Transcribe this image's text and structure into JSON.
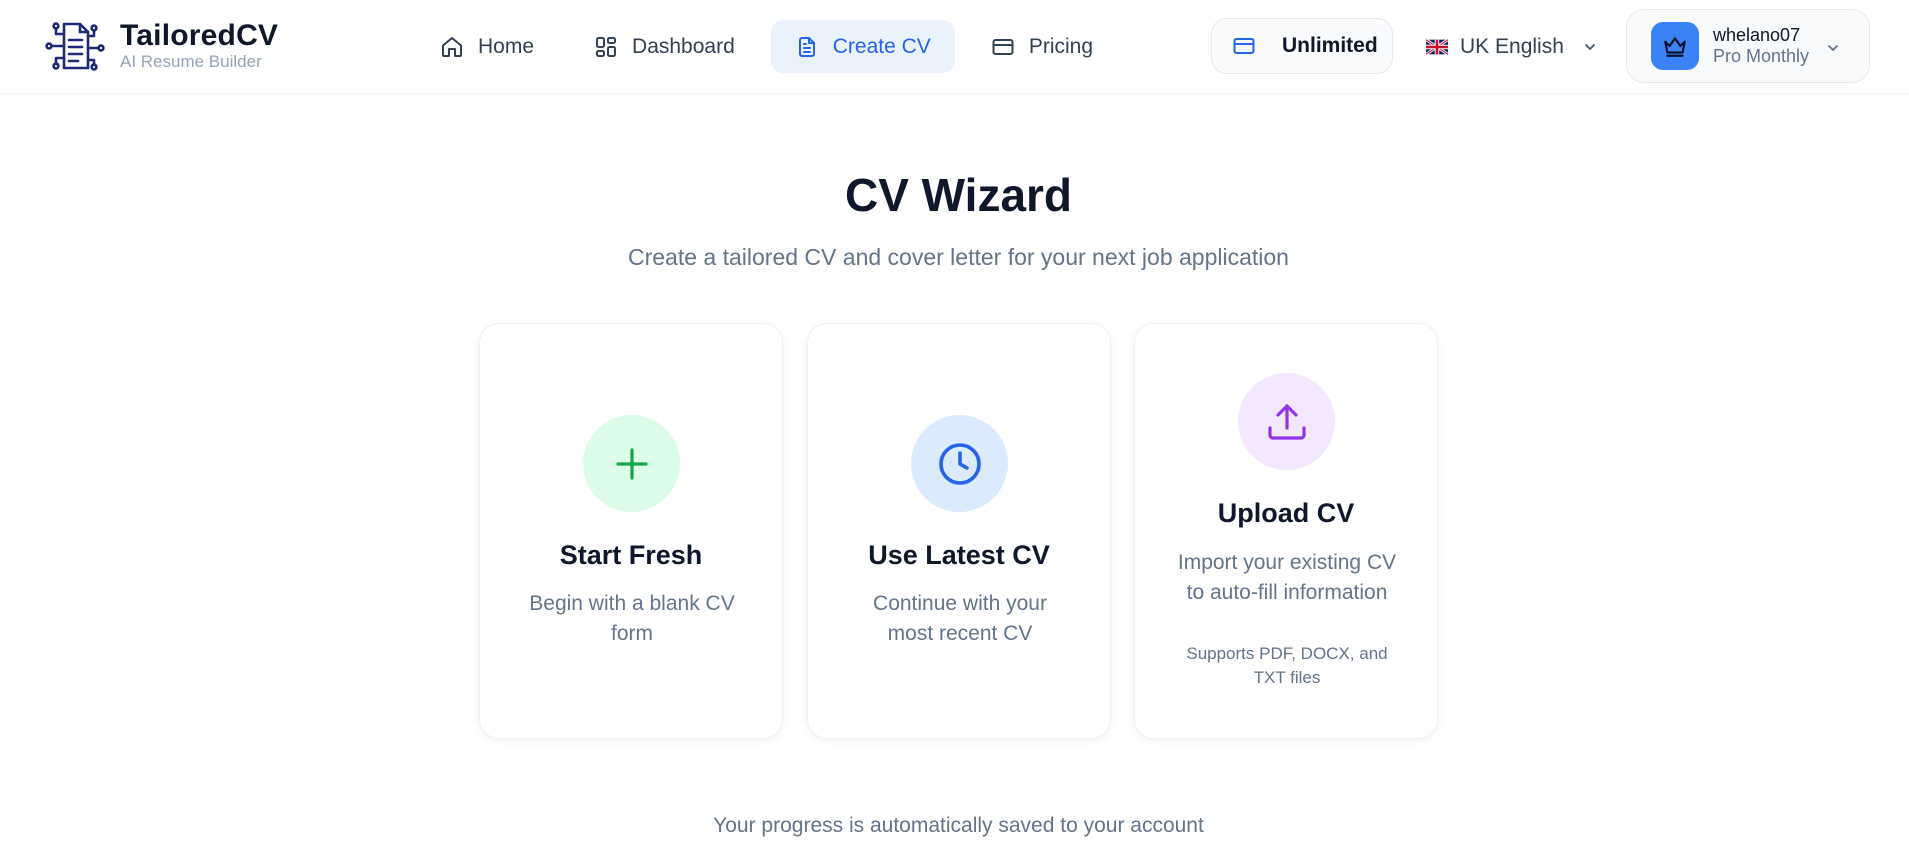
{
  "header": {
    "brand_name": "TailoredCV",
    "brand_tagline": "AI Resume Builder",
    "nav": [
      {
        "label": "Home",
        "icon": "home-icon"
      },
      {
        "label": "Dashboard",
        "icon": "dashboard-icon"
      },
      {
        "label": "Create CV",
        "icon": "document-icon",
        "active": true
      },
      {
        "label": "Pricing",
        "icon": "credit-card-icon"
      }
    ],
    "plan_label": "Unlimited",
    "language": "UK English",
    "user": {
      "name": "whelano07",
      "plan": "Pro Monthly"
    }
  },
  "main": {
    "title": "CV Wizard",
    "subtitle": "Create a tailored CV and cover letter for your next job application",
    "options": [
      {
        "title": "Start Fresh",
        "description": "Begin with a blank CV form",
        "icon": "plus-icon",
        "color": "#16a34a",
        "bg": "#dcfce7"
      },
      {
        "title": "Use Latest CV",
        "description": "Continue with your most recent CV",
        "icon": "clock-icon",
        "color": "#2563eb",
        "bg": "#dbeafe"
      },
      {
        "title": "Upload CV",
        "description": "Import your existing CV to auto-fill information",
        "note": "Supports PDF, DOCX, and TXT files",
        "icon": "upload-icon",
        "color": "#9333ea",
        "bg": "#f3e8ff"
      }
    ],
    "footer_note": "Your progress is automatically saved to your account"
  },
  "colors": {
    "accent": "#2563eb",
    "brand_navy": "#1e2a78",
    "active_nav_bg": "#eaf2fe"
  }
}
